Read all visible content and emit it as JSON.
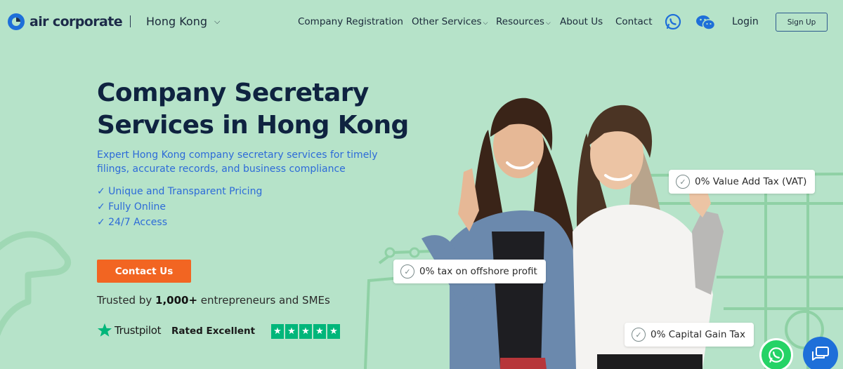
{
  "header": {
    "logo_text": "air corporate",
    "region": "Hong Kong",
    "nav": {
      "company_registration": "Company Registration",
      "other_services": "Other Services",
      "resources": "Resources",
      "about_us": "About Us",
      "contact": "Contact"
    },
    "icons": {
      "whatsapp": "whatsapp-icon",
      "wechat": "wechat-icon",
      "dropdown": "chevron-down-icon"
    },
    "login": "Login",
    "signup": "Sign Up"
  },
  "hero": {
    "title_line1": "Company Secretary",
    "title_line2": "Services in Hong Kong",
    "subtitle": "Expert Hong Kong company secretary services for timely filings, accurate records, and business compliance",
    "features": [
      "✓ Unique and Transparent Pricing",
      "✓ Fully Online",
      "✓ 24/7 Access"
    ],
    "cta": "Contact Us",
    "trusted_prefix": "Trusted by ",
    "trusted_count": "1,000+",
    "trusted_suffix": " entrepreneurs and SMEs",
    "trustpilot_word": "Trustpilot",
    "rated": "Rated Excellent",
    "star_count": 5
  },
  "badges": {
    "vat": "0% Value Add Tax (VAT)",
    "offshore": "0% tax on offshore profit",
    "capital_gain": "0% Capital Gain Tax"
  },
  "colors": {
    "background": "#b6e3c9",
    "title": "#0f2340",
    "accent_blue": "#2d6bd8",
    "cta_orange": "#f26522",
    "trustpilot_green": "#00b67a",
    "whatsapp_green": "#25d366",
    "chat_blue": "#1e6fd9"
  }
}
